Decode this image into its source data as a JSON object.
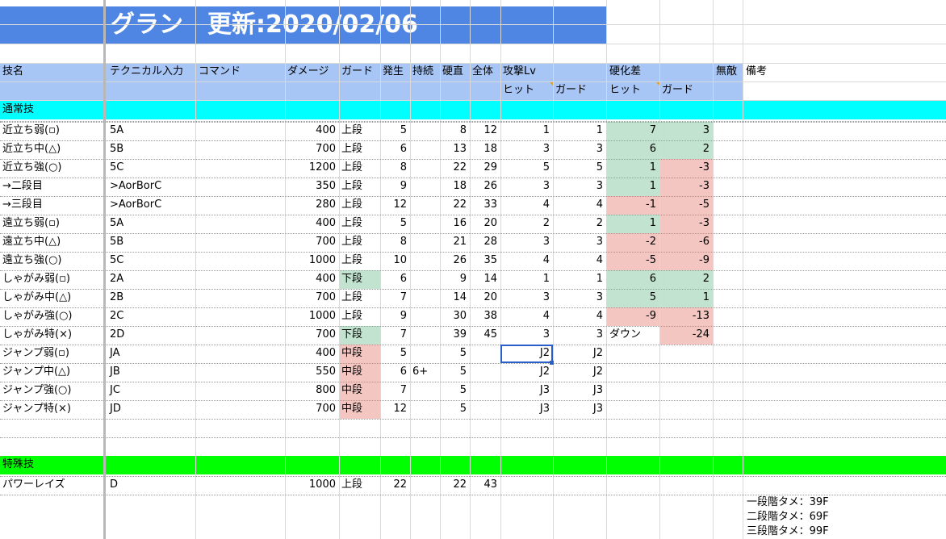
{
  "title": "グラン　更新:2020/02/06",
  "headers": {
    "name": "技名",
    "technical": "テクニカル入力",
    "command": "コマンド",
    "damage": "ダメージ",
    "guard": "ガード",
    "startup": "発生",
    "active": "持続",
    "recovery": "硬直",
    "total": "全体",
    "attack_lv": "攻撃Lv",
    "frame_adv": "硬化差",
    "invuln": "無敵",
    "notes": "備考",
    "hit": "ヒット",
    "guard_sub": "ガード"
  },
  "sections": {
    "normal": "通常技",
    "special": "特殊技"
  },
  "normal_rows": [
    {
      "name": "近立ち弱(▫)",
      "tech": "5A",
      "dmg": "400",
      "guard": "上段",
      "start": "5",
      "act": "",
      "rec": "8",
      "tot": "12",
      "lvh": "1",
      "lvg": "1",
      "advh": "7",
      "advg": "3",
      "ah": "green",
      "ag": "green",
      "gc": ""
    },
    {
      "name": "近立ち中(△)",
      "tech": "5B",
      "dmg": "700",
      "guard": "上段",
      "start": "6",
      "act": "",
      "rec": "13",
      "tot": "18",
      "lvh": "3",
      "lvg": "3",
      "advh": "6",
      "advg": "2",
      "ah": "green",
      "ag": "green",
      "gc": ""
    },
    {
      "name": "近立ち強(○)",
      "tech": "5C",
      "dmg": "1200",
      "guard": "上段",
      "start": "8",
      "act": "",
      "rec": "22",
      "tot": "29",
      "lvh": "5",
      "lvg": "5",
      "advh": "1",
      "advg": "-3",
      "ah": "green",
      "ag": "red",
      "gc": ""
    },
    {
      "name": "→二段目",
      "tech": ">AorBorC",
      "dmg": "350",
      "guard": "上段",
      "start": "9",
      "act": "",
      "rec": "18",
      "tot": "26",
      "lvh": "3",
      "lvg": "3",
      "advh": "1",
      "advg": "-3",
      "ah": "green",
      "ag": "red",
      "gc": ""
    },
    {
      "name": "→三段目",
      "tech": ">AorBorC",
      "dmg": "280",
      "guard": "上段",
      "start": "12",
      "act": "",
      "rec": "22",
      "tot": "33",
      "lvh": "4",
      "lvg": "4",
      "advh": "-1",
      "advg": "-5",
      "ah": "red",
      "ag": "red",
      "gc": ""
    },
    {
      "name": "遠立ち弱(▫)",
      "tech": "5A",
      "dmg": "400",
      "guard": "上段",
      "start": "5",
      "act": "",
      "rec": "16",
      "tot": "20",
      "lvh": "2",
      "lvg": "2",
      "advh": "1",
      "advg": "-3",
      "ah": "green",
      "ag": "red",
      "gc": ""
    },
    {
      "name": "遠立ち中(△)",
      "tech": "5B",
      "dmg": "700",
      "guard": "上段",
      "start": "8",
      "act": "",
      "rec": "21",
      "tot": "28",
      "lvh": "3",
      "lvg": "3",
      "advh": "-2",
      "advg": "-6",
      "ah": "red",
      "ag": "red",
      "gc": ""
    },
    {
      "name": "遠立ち強(○)",
      "tech": "5C",
      "dmg": "1000",
      "guard": "上段",
      "start": "10",
      "act": "",
      "rec": "26",
      "tot": "35",
      "lvh": "4",
      "lvg": "4",
      "advh": "-5",
      "advg": "-9",
      "ah": "red",
      "ag": "red",
      "gc": ""
    },
    {
      "name": "しゃがみ弱(▫)",
      "tech": "2A",
      "dmg": "400",
      "guard": "下段",
      "start": "6",
      "act": "",
      "rec": "9",
      "tot": "14",
      "lvh": "1",
      "lvg": "1",
      "advh": "6",
      "advg": "2",
      "ah": "green",
      "ag": "green",
      "gc": "green"
    },
    {
      "name": "しゃがみ中(△)",
      "tech": "2B",
      "dmg": "700",
      "guard": "上段",
      "start": "7",
      "act": "",
      "rec": "14",
      "tot": "20",
      "lvh": "3",
      "lvg": "3",
      "advh": "5",
      "advg": "1",
      "ah": "green",
      "ag": "green",
      "gc": ""
    },
    {
      "name": "しゃがみ強(○)",
      "tech": "2C",
      "dmg": "1000",
      "guard": "上段",
      "start": "9",
      "act": "",
      "rec": "30",
      "tot": "38",
      "lvh": "4",
      "lvg": "4",
      "advh": "-9",
      "advg": "-13",
      "ah": "red",
      "ag": "red",
      "gc": ""
    },
    {
      "name": "しゃがみ特(×)",
      "tech": "2D",
      "dmg": "700",
      "guard": "下段",
      "start": "7",
      "act": "",
      "rec": "39",
      "tot": "45",
      "lvh": "3",
      "lvg": "3",
      "advh": "ダウン",
      "advg": "-24",
      "ah": "",
      "ag": "red",
      "gc": "green"
    },
    {
      "name": "ジャンプ弱(▫)",
      "tech": "JA",
      "dmg": "400",
      "guard": "中段",
      "start": "5",
      "act": "",
      "rec": "5",
      "tot": "",
      "lvh": "J2",
      "lvg": "J2",
      "advh": "",
      "advg": "",
      "ah": "",
      "ag": "",
      "gc": "red"
    },
    {
      "name": "ジャンプ中(△)",
      "tech": "JB",
      "dmg": "550",
      "guard": "中段",
      "start": "6",
      "act": "6+",
      "rec": "5",
      "tot": "",
      "lvh": "J2",
      "lvg": "J2",
      "advh": "",
      "advg": "",
      "ah": "",
      "ag": "",
      "gc": "red"
    },
    {
      "name": "ジャンプ強(○)",
      "tech": "JC",
      "dmg": "800",
      "guard": "中段",
      "start": "7",
      "act": "",
      "rec": "5",
      "tot": "",
      "lvh": "J3",
      "lvg": "J3",
      "advh": "",
      "advg": "",
      "ah": "",
      "ag": "",
      "gc": "red"
    },
    {
      "name": "ジャンプ特(×)",
      "tech": "JD",
      "dmg": "700",
      "guard": "中段",
      "start": "12",
      "act": "",
      "rec": "5",
      "tot": "",
      "lvh": "J3",
      "lvg": "J3",
      "advh": "",
      "advg": "",
      "ah": "",
      "ag": "",
      "gc": "red"
    }
  ],
  "special_rows": [
    {
      "name": "パワーレイズ",
      "tech": "D",
      "dmg": "1000",
      "guard": "上段",
      "start": "22",
      "act": "",
      "rec": "22",
      "tot": "43",
      "lvh": "",
      "lvg": "",
      "advh": "",
      "advg": "",
      "ah": "",
      "ag": "",
      "gc": ""
    }
  ],
  "notes": [
    "一段階タメ：39F",
    "二段階タメ：69F",
    "三段階タメ：99F"
  ],
  "colors": {
    "title_bg": "#4f86e4",
    "header_bg": "#a8c6f5",
    "normal_section": "#00ffff",
    "special_section": "#00ff00",
    "green": "#c2e3cf",
    "red": "#f4c6c2"
  }
}
